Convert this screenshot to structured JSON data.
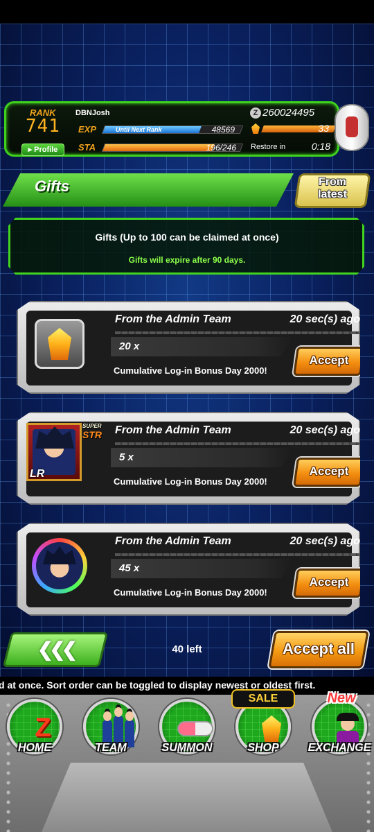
{
  "player": {
    "rank_label": "RANK",
    "rank": "741",
    "name": "DBNJosh",
    "profile_label": "Profile",
    "exp_label": "EXP",
    "until_next_rank_label": "Until Next Rank",
    "exp_to_next": "48569",
    "exp_progress": 0.7,
    "sta_label": "STA",
    "stamina": "196/246",
    "stamina_progress": 0.8,
    "zeni_icon": "Z",
    "zeni": "260024495",
    "dragon_stones": "33",
    "restore_label": "Restore in",
    "restore_time": "0:18"
  },
  "gifts": {
    "title": "Gifts",
    "sort_label": "From latest",
    "info_title": "Gifts (Up to 100 can be claimed at once)",
    "info_sub": "Gifts will expire after 90 days."
  },
  "gift_items": [
    {
      "from": "From the Admin Team",
      "time": "20 sec(s) ago",
      "qty": "20 x",
      "desc": "Cumulative Log-in Bonus Day 2000!",
      "accept_label": "Accept",
      "icon": "dragon-stone-icon"
    },
    {
      "from": "From the Admin Team",
      "time": "20 sec(s) ago",
      "qty": "5 x",
      "desc": "Cumulative Log-in Bonus Day 2000!",
      "accept_label": "Accept",
      "icon": "character-card-icon",
      "card_type_top": "SUPER",
      "card_type": "STR",
      "card_rarity": "LR"
    },
    {
      "from": "From the Admin Team",
      "time": "20 sec(s) ago",
      "qty": "45 x",
      "desc": "Cumulative Log-in Bonus Day 2000!",
      "accept_label": "Accept",
      "icon": "support-medal-icon"
    }
  ],
  "footer": {
    "back_label": "❮❮❮",
    "remaining": "40 left",
    "accept_all_label": "Accept all",
    "ticker": "d at once. Sort order can be toggled to display newest or oldest first."
  },
  "nav": {
    "home": "HOME",
    "team": "TEAM",
    "summon": "SUMMON",
    "shop": "SHOP",
    "exchange": "EXCHANGE",
    "sale_badge": "SALE",
    "new_badge": "New"
  }
}
